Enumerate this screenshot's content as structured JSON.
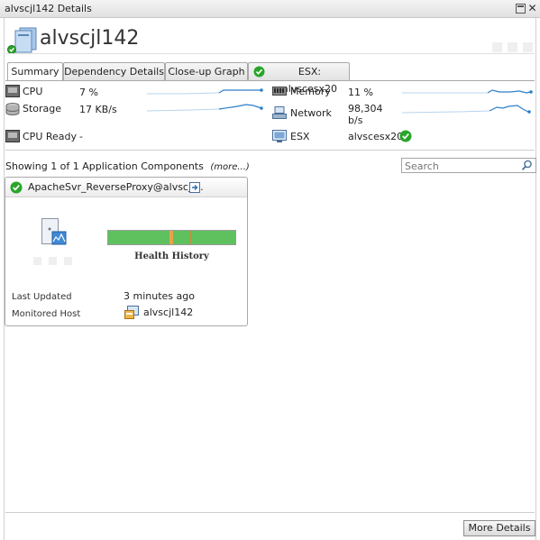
{
  "window": {
    "title": "alvscjl142 Details"
  },
  "host": {
    "name": "alvscjl142"
  },
  "tabs": [
    {
      "label": "Summary",
      "active": true
    },
    {
      "label": "Dependency Details",
      "active": false
    },
    {
      "label": "Close-up Graph",
      "active": false
    },
    {
      "label": "ESX: alvscesx20",
      "active": false,
      "status": "ok"
    }
  ],
  "metrics": {
    "cpu": {
      "label": "CPU",
      "value": "7 %",
      "icon": "cpu-icon"
    },
    "storage": {
      "label": "Storage",
      "value": "17 KB/s",
      "icon": "storage-icon"
    },
    "cpu_ready": {
      "label": "CPU Ready",
      "value": "-",
      "icon": "cpu-ready-icon"
    },
    "memory": {
      "label": "Memory",
      "value": "11 %",
      "icon": "memory-icon"
    },
    "network": {
      "label": "Network",
      "value_line1": "98,304",
      "value_line2": "b/s",
      "icon": "network-icon"
    },
    "esx": {
      "label": "ESX",
      "value": "alvscesx20",
      "icon": "esx-icon",
      "status": "ok"
    }
  },
  "components": {
    "showing_text": "Showing 1 of 1 Application Components",
    "more_link": "(more...)",
    "search_placeholder": "Search"
  },
  "card": {
    "title": "ApacheSvr_ReverseProxy@alvscjl...",
    "status": "ok",
    "health_label": "Health History",
    "last_updated_label": "Last Updated",
    "last_updated_value": "3 minutes ago",
    "monitored_host_label": "Monitored Host",
    "monitored_host_value": "alvscjl142"
  },
  "footer": {
    "more_details_label": "More Details"
  },
  "colors": {
    "ok_green": "#2aa52a",
    "health_green": "#5ec15e",
    "health_orange": "#e8a34a",
    "spark_blue": "#2d7fc9"
  }
}
